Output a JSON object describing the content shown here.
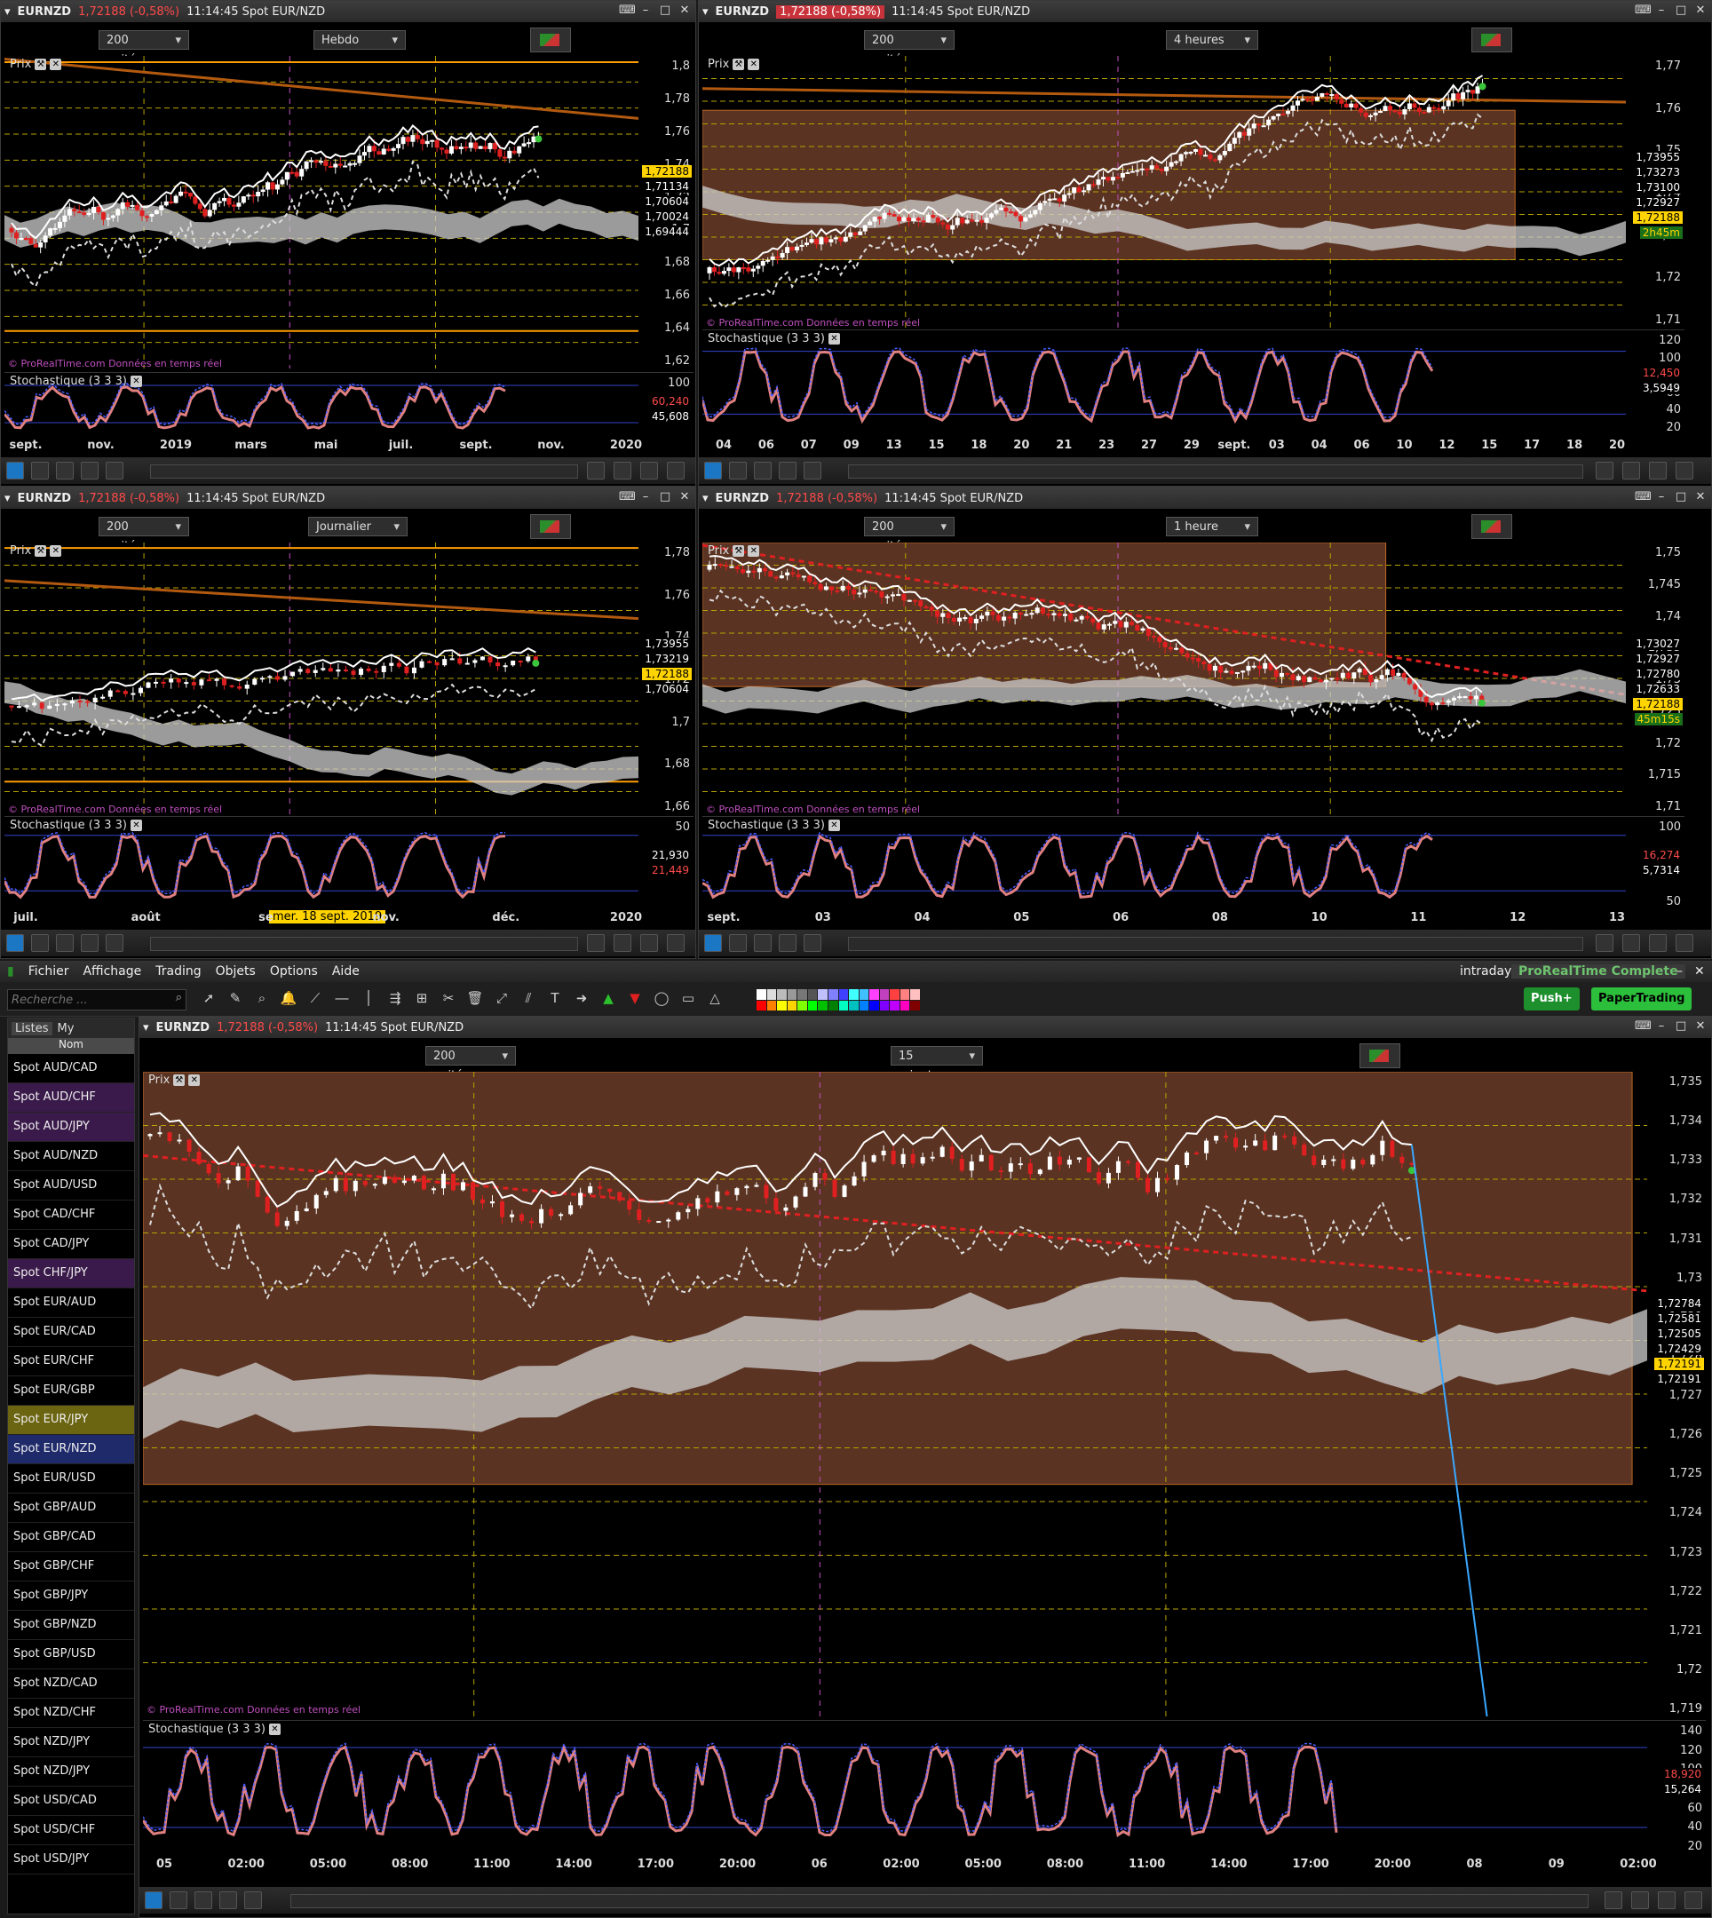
{
  "symbol": "EURNZD",
  "price_pct": "1,72188 (-0,58%)",
  "time_desc": "11:14:45  Spot EUR/NZD",
  "units": "200 unités",
  "prix": "Prix",
  "stoch": "Stochastique (3 3 3)",
  "copyright": "© ProRealTime.com  Données en temps réel",
  "last": "1,72188",
  "win1": {
    "tf": "Hebdo",
    "yticks": [
      "1,8",
      "1,78",
      "1,76",
      "1,74",
      "1,72",
      "1,7",
      "1,68",
      "1,66",
      "1,64",
      "1,62"
    ],
    "tags": [
      [
        "1,72188",
        "#ffd400",
        "#000"
      ],
      [
        "1,71134",
        "#000",
        "#fff"
      ],
      [
        "1,70604",
        "#000",
        "#fff"
      ],
      [
        "1,70024",
        "#000",
        "#fff"
      ],
      [
        "1,69444",
        "#000",
        "#fff"
      ]
    ],
    "stoch_ticks": [
      "100"
    ],
    "stoch_tags": [
      [
        "60,240",
        "#000",
        "#ff4a4a"
      ],
      [
        "45,608",
        "#000",
        "#fff"
      ]
    ],
    "x": [
      "sept.",
      "nov.",
      "2019",
      "mars",
      "mai",
      "juil.",
      "sept.",
      "nov.",
      "2020"
    ]
  },
  "win2": {
    "tf": "4 heures",
    "yticks": [
      "1,77",
      "1,76",
      "1,75",
      "1,74",
      "1,73",
      "1,72",
      "1,71"
    ],
    "tags": [
      [
        "1,73955",
        "#000",
        "#fff"
      ],
      [
        "1,73273",
        "#000",
        "#fff"
      ],
      [
        "1,73100",
        "#000",
        "#fff"
      ],
      [
        "1,72927",
        "#000",
        "#fff"
      ],
      [
        "1,72188",
        "#ffd400",
        "#000"
      ],
      [
        "2h45m",
        "#1a6f1a",
        "#ffd400"
      ]
    ],
    "stoch_ticks": [
      "120",
      "100",
      "80",
      "60",
      "40",
      "20"
    ],
    "stoch_tags": [
      [
        "12,450",
        "#000",
        "#ff4a4a"
      ],
      [
        "3,5949",
        "#000",
        "#fff"
      ]
    ],
    "x": [
      "04",
      "06",
      "07",
      "09",
      "13",
      "15",
      "18",
      "20",
      "21",
      "23",
      "27",
      "29",
      "sept.",
      "03",
      "04",
      "06",
      "10",
      "12",
      "15",
      "17",
      "18",
      "20"
    ]
  },
  "win3": {
    "tf": "Journalier",
    "yticks": [
      "1,78",
      "1,76",
      "1,74",
      "1,72",
      "1,7",
      "1,68",
      "1,66"
    ],
    "tags": [
      [
        "1,73955",
        "#000",
        "#fff"
      ],
      [
        "1,73219",
        "#000",
        "#fff"
      ],
      [
        "1,72188",
        "#ffd400",
        "#000"
      ],
      [
        "1,70604",
        "#000",
        "#fff"
      ]
    ],
    "stoch_ticks": [
      "50"
    ],
    "stoch_tags": [
      [
        "21,930",
        "#000",
        "#fff"
      ],
      [
        "21,449",
        "#000",
        "#ff4a4a"
      ]
    ],
    "x": [
      "juil.",
      "août",
      "se",
      "nov.",
      "déc.",
      "2020"
    ],
    "cursor_date": "mer. 18 sept. 2019"
  },
  "win4": {
    "tf": "1 heure",
    "yticks": [
      "1,75",
      "1,745",
      "1,74",
      "1,735",
      "1,73",
      "1,725",
      "1,72",
      "1,715",
      "1,71"
    ],
    "tags": [
      [
        "1,73027",
        "#000",
        "#fff"
      ],
      [
        "1,72927",
        "#000",
        "#fff"
      ],
      [
        "1,72780",
        "#000",
        "#fff"
      ],
      [
        "1,72633",
        "#000",
        "#fff"
      ],
      [
        "1,72188",
        "#ffd400",
        "#000"
      ],
      [
        "45m15s",
        "#1a6f1a",
        "#ffd400"
      ]
    ],
    "stoch_ticks": [
      "100",
      "50"
    ],
    "stoch_tags": [
      [
        "16,274",
        "#000",
        "#ff4a4a"
      ],
      [
        "5,7314",
        "#000",
        "#fff"
      ]
    ],
    "x": [
      "sept.",
      "03",
      "04",
      "05",
      "06",
      "08",
      "10",
      "11",
      "12",
      "13"
    ]
  },
  "menu": [
    "Fichier",
    "Affichage",
    "Trading",
    "Objets",
    "Options",
    "Aide"
  ],
  "intraday": "intraday",
  "product": "ProRealTime Complete",
  "push_btn": "Push+",
  "paper_btn": "PaperTrading",
  "search_placeholder": "Recherche ...",
  "tabs": [
    "Listes",
    "My"
  ],
  "col_nom": "Nom",
  "watchlist": [
    [
      "Spot AUD/CAD",
      "#000"
    ],
    [
      "Spot AUD/CHF",
      "#3a1a4a"
    ],
    [
      "Spot AUD/JPY",
      "#3a1a4a"
    ],
    [
      "Spot AUD/NZD",
      "#000"
    ],
    [
      "Spot AUD/USD",
      "#000"
    ],
    [
      "Spot CAD/CHF",
      "#000"
    ],
    [
      "Spot CAD/JPY",
      "#000"
    ],
    [
      "Spot CHF/JPY",
      "#3a1a4a"
    ],
    [
      "Spot EUR/AUD",
      "#000"
    ],
    [
      "Spot EUR/CAD",
      "#000"
    ],
    [
      "Spot EUR/CHF",
      "#000"
    ],
    [
      "Spot EUR/GBP",
      "#000"
    ],
    [
      "Spot EUR/JPY",
      "#6b6410"
    ],
    [
      "Spot EUR/NZD",
      "#1e2a6a"
    ],
    [
      "Spot EUR/USD",
      "#000"
    ],
    [
      "Spot GBP/AUD",
      "#000"
    ],
    [
      "Spot GBP/CAD",
      "#000"
    ],
    [
      "Spot GBP/CHF",
      "#000"
    ],
    [
      "Spot GBP/JPY",
      "#000"
    ],
    [
      "Spot GBP/NZD",
      "#000"
    ],
    [
      "Spot GBP/USD",
      "#000"
    ],
    [
      "Spot NZD/CAD",
      "#000"
    ],
    [
      "Spot NZD/CHF",
      "#000"
    ],
    [
      "Spot NZD/JPY",
      "#000"
    ],
    [
      "Spot NZD/JPY",
      "#000"
    ],
    [
      "Spot USD/CAD",
      "#000"
    ],
    [
      "Spot USD/CHF",
      "#000"
    ],
    [
      "Spot USD/JPY",
      "#000"
    ]
  ],
  "win5": {
    "tf": "15 minutes",
    "yticks": [
      "1,735",
      "1,734",
      "1,733",
      "1,732",
      "1,731",
      "1,73",
      "1,729",
      "1,728",
      "1,727",
      "1,726",
      "1,725",
      "1,724",
      "1,723",
      "1,722",
      "1,721",
      "1,72",
      "1,719"
    ],
    "tags": [
      [
        "1,72784",
        "#000",
        "#fff"
      ],
      [
        "1,72581",
        "#000",
        "#fff"
      ],
      [
        "1,72505",
        "#000",
        "#fff"
      ],
      [
        "1,72429",
        "#000",
        "#fff"
      ],
      [
        "1,72191",
        "#ffd400",
        "#000"
      ],
      [
        "1,72191",
        "#000",
        "#fff"
      ]
    ],
    "stoch_ticks": [
      "140",
      "120",
      "100",
      "80",
      "60",
      "40",
      "20"
    ],
    "stoch_tags": [
      [
        "18,920",
        "#000",
        "#ff4a4a"
      ],
      [
        "15,264",
        "#000",
        "#fff"
      ]
    ],
    "x": [
      "05",
      "02:00",
      "05:00",
      "08:00",
      "11:00",
      "14:00",
      "17:00",
      "20:00",
      "06",
      "02:00",
      "05:00",
      "08:00",
      "11:00",
      "14:00",
      "17:00",
      "20:00",
      "08",
      "09",
      "02:00"
    ]
  }
}
